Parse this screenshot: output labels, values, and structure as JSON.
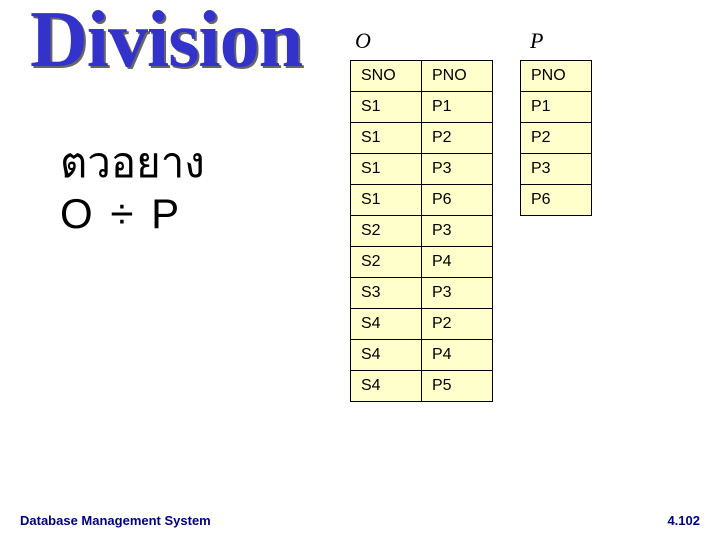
{
  "title": "Division",
  "subtitle": "ตวอยาง",
  "expression_left": "O",
  "expression_op": "÷",
  "expression_right": "P",
  "tableO": {
    "name": "O",
    "headers": [
      "SNO",
      "PNO"
    ],
    "rows": [
      [
        "S1",
        "P1"
      ],
      [
        "S1",
        "P2"
      ],
      [
        "S1",
        "P3"
      ],
      [
        "S1",
        "P6"
      ],
      [
        "S2",
        "P3"
      ],
      [
        "S2",
        "P4"
      ],
      [
        "S3",
        "P3"
      ],
      [
        "S4",
        "P2"
      ],
      [
        "S4",
        "P4"
      ],
      [
        "S4",
        "P5"
      ]
    ]
  },
  "tableP": {
    "name": "P",
    "headers": [
      "PNO"
    ],
    "rows": [
      [
        "P1"
      ],
      [
        "P2"
      ],
      [
        "P3"
      ],
      [
        "P6"
      ]
    ]
  },
  "footer": {
    "left": "Database Management System",
    "right": "4.102"
  }
}
